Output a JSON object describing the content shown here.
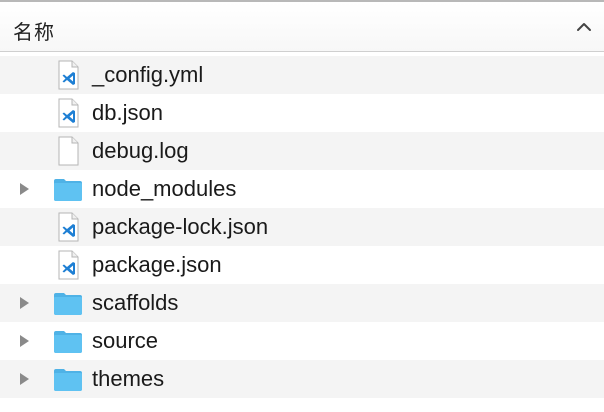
{
  "header": {
    "title": "名称",
    "sort_direction": "ascending",
    "sort_icon": "chevron-up-icon"
  },
  "colors": {
    "folder": "#5fc2f2",
    "vscode_blue": "#1e7fd4",
    "row_alt": "#f4f4f4"
  },
  "files": [
    {
      "name": "_config.yml",
      "kind": "vscode-file",
      "expandable": false
    },
    {
      "name": "db.json",
      "kind": "vscode-file",
      "expandable": false
    },
    {
      "name": "debug.log",
      "kind": "plain-file",
      "expandable": false
    },
    {
      "name": "node_modules",
      "kind": "folder",
      "expandable": true
    },
    {
      "name": "package-lock.json",
      "kind": "vscode-file",
      "expandable": false
    },
    {
      "name": "package.json",
      "kind": "vscode-file",
      "expandable": false
    },
    {
      "name": "scaffolds",
      "kind": "folder",
      "expandable": true
    },
    {
      "name": "source",
      "kind": "folder",
      "expandable": true
    },
    {
      "name": "themes",
      "kind": "folder",
      "expandable": true
    }
  ]
}
